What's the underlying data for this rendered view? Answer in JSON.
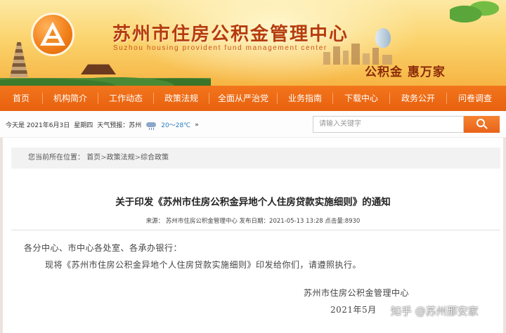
{
  "banner": {
    "title": "苏州市住房公积金管理中心",
    "subtitle": "Suzhou housing provident fund management center",
    "slogan": "公积金 惠万家"
  },
  "nav": {
    "items": [
      {
        "label": "首页"
      },
      {
        "label": "机构简介"
      },
      {
        "label": "工作动态"
      },
      {
        "label": "政策法规"
      },
      {
        "label": "全面从严治党"
      },
      {
        "label": "业务指南"
      },
      {
        "label": "下载中心"
      },
      {
        "label": "政务公开"
      },
      {
        "label": "问卷调查"
      }
    ]
  },
  "infobar": {
    "date": "今天是 2021年6月3日",
    "weekday": "星期四",
    "forecast_label": "天气预报：",
    "city": "苏州",
    "temperature": "20～28℃",
    "more": "»"
  },
  "search": {
    "placeholder": "请输入关键字"
  },
  "breadcrumb": {
    "prefix": "您当前所在位置：",
    "items": [
      "首页",
      "政策法规",
      "综合政策"
    ],
    "separator": ">"
  },
  "article": {
    "title": "关于印发《苏州市住房公积金异地个人住房贷款实施细则》的通知",
    "meta": "来源： 苏州市住房公积金管理中心  发布日期：2021-05-13 13:28  点击量:8930",
    "salutation": "各分中心、市中心各处室、各承办银行：",
    "body": "现将《苏州市住房公积金异地个人住房贷款实施细则》印发给你们，请遵照执行。",
    "signature": "苏州市住房公积金管理中心",
    "date": "2021年5月"
  },
  "watermark": "知乎 @苏州那安家",
  "colors": {
    "nav": "#e8610f",
    "title": "#b63c0c",
    "slogan": "#8b2a08"
  }
}
